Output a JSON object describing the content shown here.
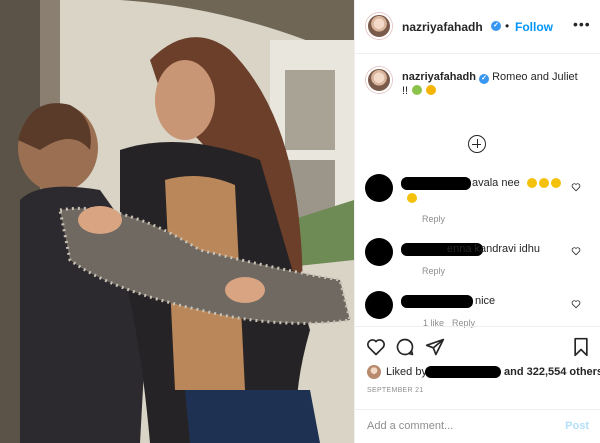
{
  "post": {
    "username": "nazriyafahadh",
    "follow_label": "Follow",
    "separator": "•",
    "more_icon": "more-horizontal-icon",
    "caption": {
      "username": "nazriyafahadh",
      "text": "Romeo and Juliet",
      "line2": "!!"
    }
  },
  "comments": [
    {
      "text": "avala nee",
      "reply_label": "Reply",
      "meta": ""
    },
    {
      "text": "enna kandravi idhu",
      "reply_label": "Reply",
      "meta": ""
    },
    {
      "text": "nice",
      "reply_label": "Reply",
      "meta": "1 like"
    }
  ],
  "actions": {
    "like_icon": "heart-icon",
    "comment_icon": "comment-icon",
    "share_icon": "share-icon",
    "save_icon": "bookmark-icon",
    "liked_prefix": "Liked by",
    "liked_suffix": "and 322,554 others",
    "date": "SEPTEMBER 21",
    "add_comment_placeholder": "Add a comment...",
    "post_label": "Post"
  },
  "colors": {
    "accent": "#0095f6",
    "verified": "#3897f0",
    "muted": "#8e8e8e"
  }
}
